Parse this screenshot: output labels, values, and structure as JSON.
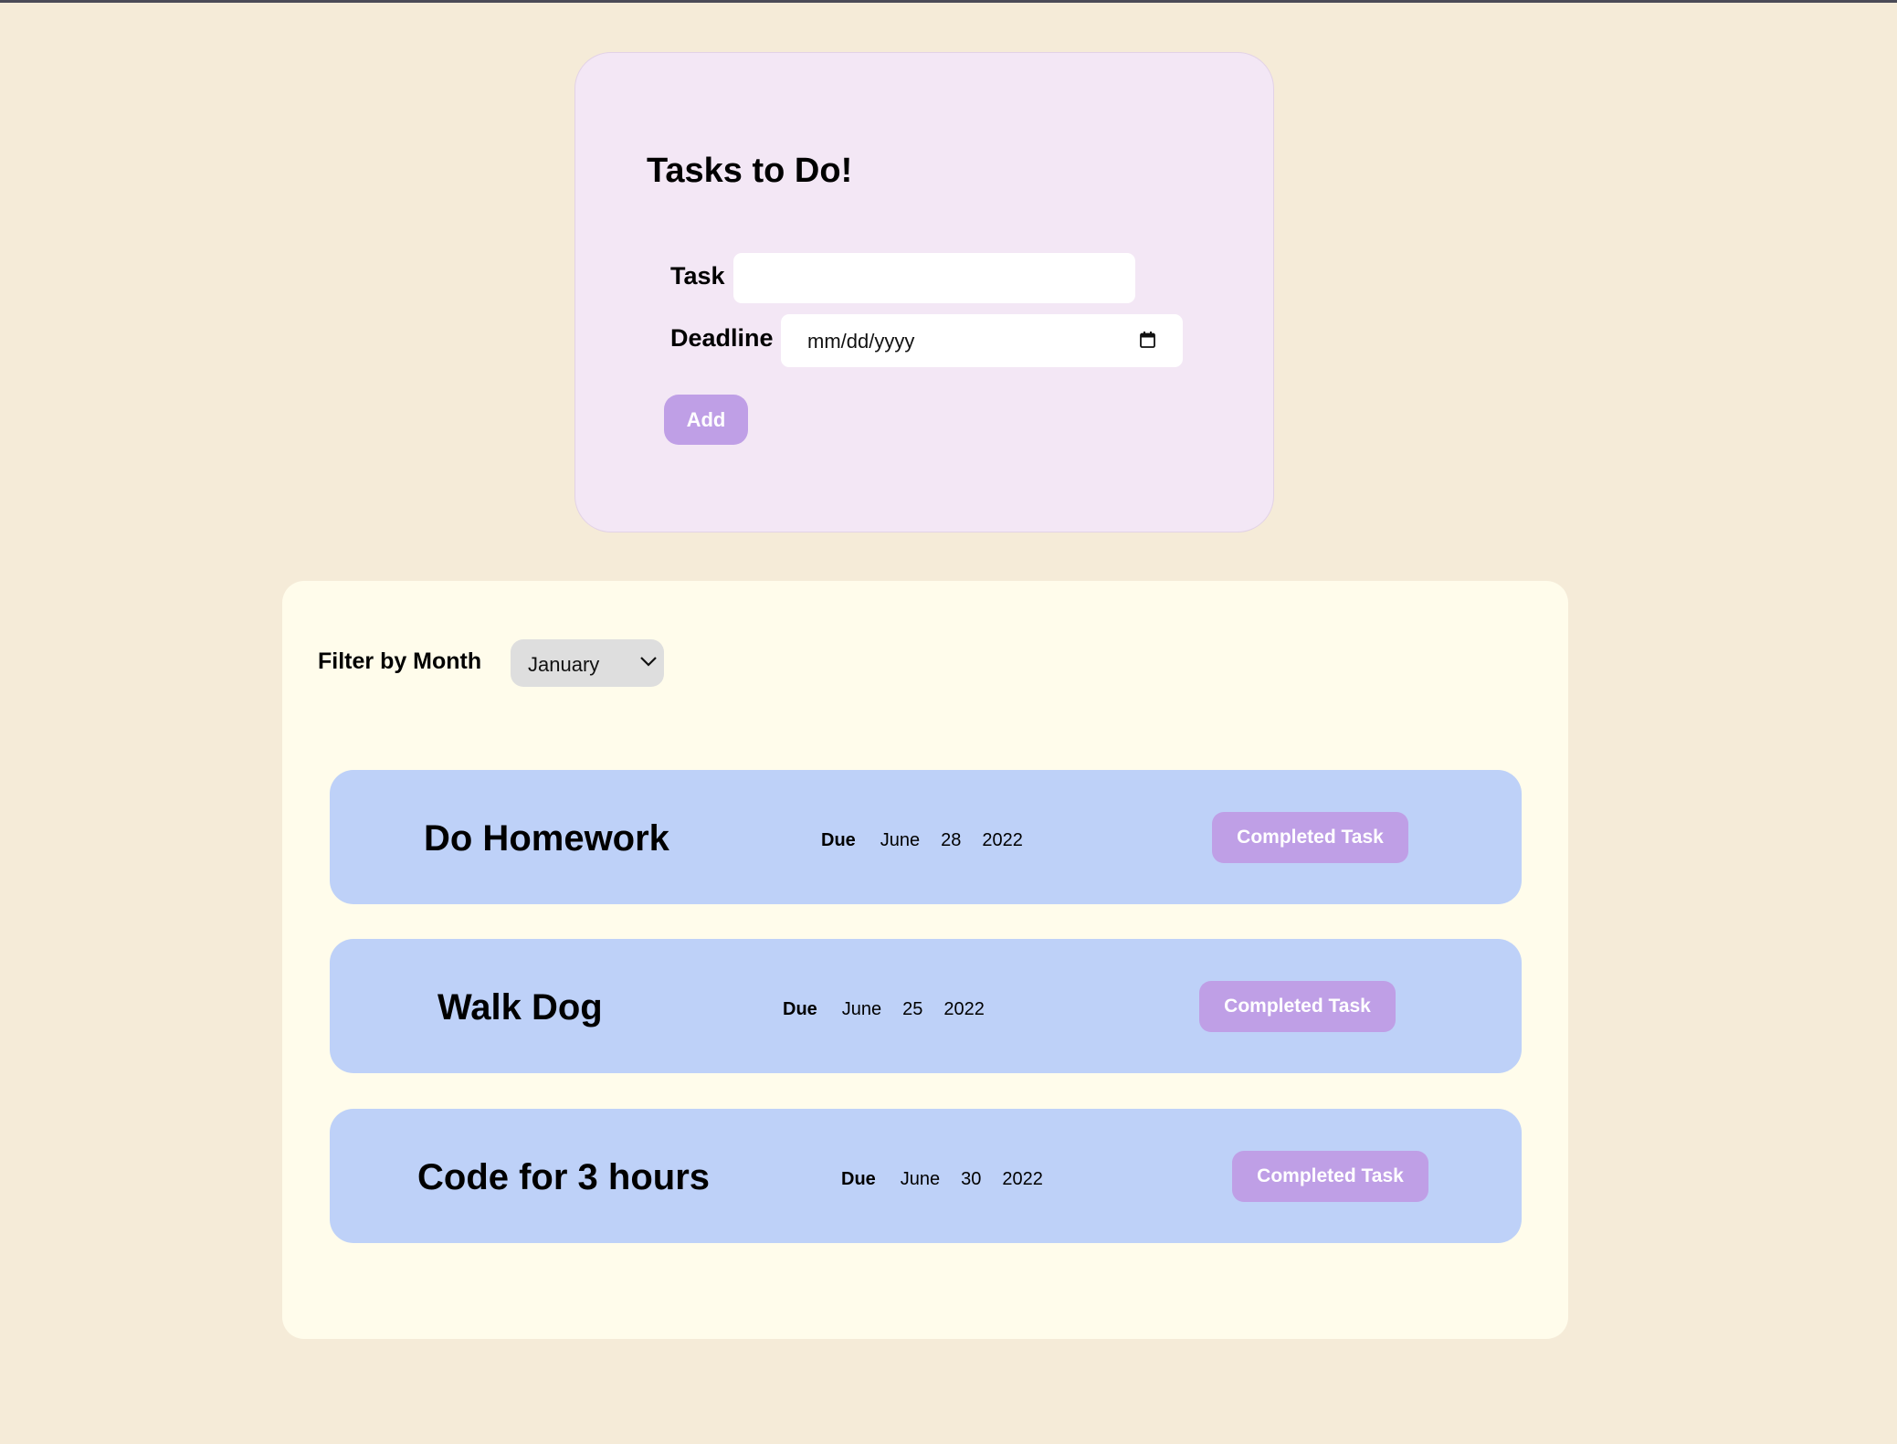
{
  "form": {
    "title": "Tasks to Do!",
    "task_label": "Task",
    "task_value": "",
    "deadline_label": "Deadline",
    "deadline_placeholder": "mm/dd/yyyy",
    "add_label": "Add"
  },
  "filter": {
    "label": "Filter by Month",
    "selected": "January"
  },
  "tasks": [
    {
      "title": "Do Homework",
      "due_label": "Due",
      "month": "June",
      "day": "28",
      "year": "2022",
      "button": "Completed Task"
    },
    {
      "title": "Walk Dog",
      "due_label": "Due",
      "month": "June",
      "day": "25",
      "year": "2022",
      "button": "Completed Task"
    },
    {
      "title": "Code for 3 hours",
      "due_label": "Due",
      "month": "June",
      "day": "30",
      "year": "2022",
      "button": "Completed Task"
    }
  ],
  "colors": {
    "page_bg": "#f5ebd8",
    "form_card_bg": "#f3e7f5",
    "list_panel_bg": "#fffceb",
    "task_row_bg": "#bed1f8",
    "button_bg": "#bf9fe6",
    "select_bg": "#dedede"
  },
  "icons": {
    "calendar": "calendar-icon",
    "select_arrow": "chevron-down-icon"
  }
}
